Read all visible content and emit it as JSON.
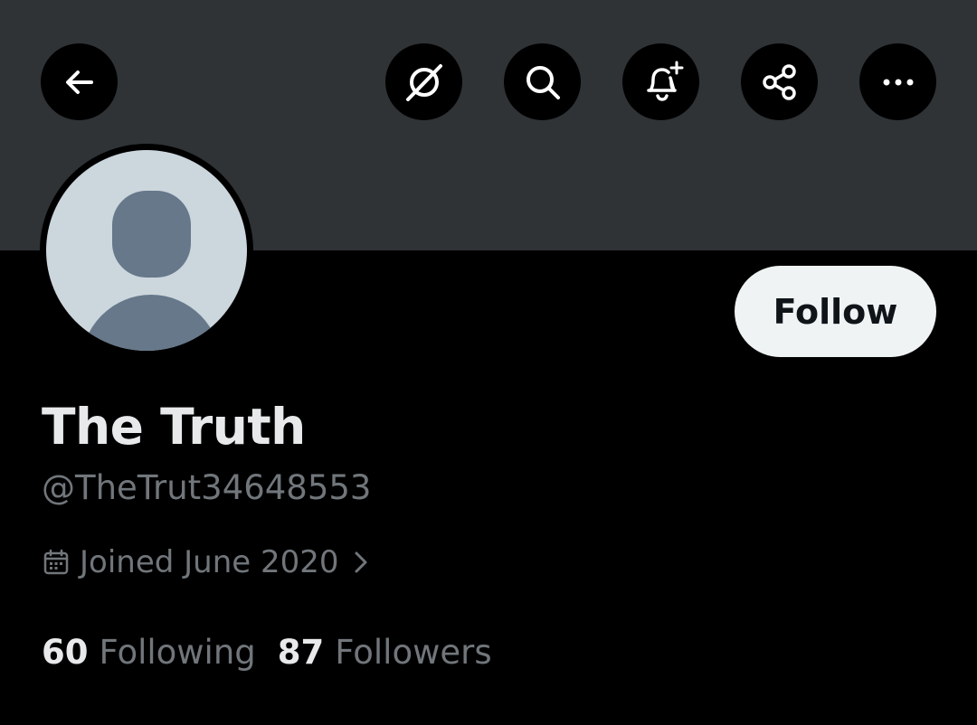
{
  "profile": {
    "display_name": "The Truth",
    "handle": "@TheTrut34648553",
    "joined": "Joined June 2020",
    "following_count": "60",
    "following_label": "Following",
    "followers_count": "87",
    "followers_label": "Followers"
  },
  "actions": {
    "follow_label": "Follow"
  },
  "toolbar": {
    "icons": [
      "back-arrow-icon",
      "grok-icon",
      "search-icon",
      "bell-plus-icon",
      "share-icon",
      "more-icon"
    ]
  },
  "colors": {
    "banner": "#2f3336",
    "background": "#000000",
    "primary_text": "#e7e9ea",
    "secondary_text": "#71767b",
    "follow_button_bg": "#eff3f4",
    "avatar_bg": "#ccd6dd",
    "avatar_silhouette": "#66788a"
  }
}
